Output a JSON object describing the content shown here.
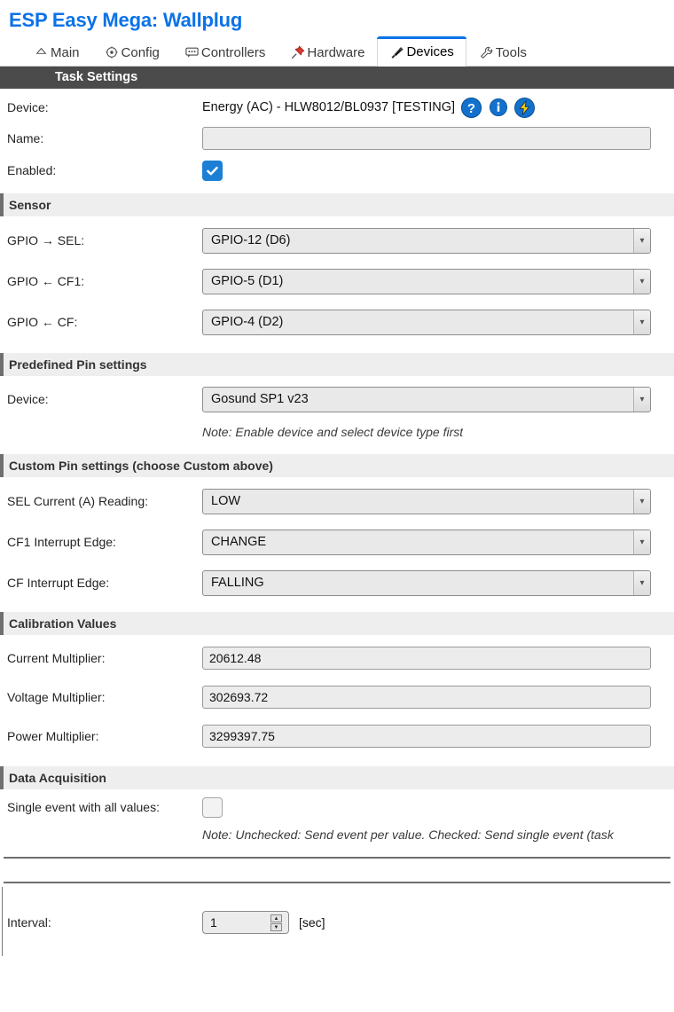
{
  "header": {
    "title": "ESP Easy Mega: Wallplug",
    "title_color": "#0b72e7"
  },
  "tabs": [
    {
      "label": "Main",
      "icon": "home-icon",
      "active": false
    },
    {
      "label": "Config",
      "icon": "gear-icon",
      "active": false
    },
    {
      "label": "Controllers",
      "icon": "speech-bubble-icon",
      "active": false
    },
    {
      "label": "Hardware",
      "icon": "pushpin-icon",
      "active": false
    },
    {
      "label": "Devices",
      "icon": "plug-icon",
      "active": true
    },
    {
      "label": "Tools",
      "icon": "wrench-icon",
      "active": false
    }
  ],
  "task_settings": {
    "bar_label": "Task Settings",
    "bar_color": "#4b4b4b"
  },
  "device": {
    "label": "Device:",
    "value": "Energy (AC) - HLW8012/BL0937 [TESTING]",
    "icons": [
      {
        "name": "help-icon",
        "glyph": "?",
        "bg": "#1271cd",
        "fg": "#ffffff"
      },
      {
        "name": "info-icon",
        "glyph": "i",
        "bg": "#1271cd",
        "fg": "#ffffff"
      },
      {
        "name": "lightning-icon",
        "glyph": "⚡",
        "bg": "#1271cd",
        "fg": "#f4c518"
      }
    ]
  },
  "name_field": {
    "label": "Name:",
    "value": "",
    "placeholder": ""
  },
  "enabled_field": {
    "label": "Enabled:",
    "checked": true
  },
  "sensor_section": {
    "title": "Sensor",
    "rows": [
      {
        "label": "GPIO → SEL:",
        "value": "GPIO-12 (D6)",
        "name": "gpio-sel-select"
      },
      {
        "label": "GPIO ← CF1:",
        "value": "GPIO-5 (D1)",
        "name": "gpio-cf1-select"
      },
      {
        "label": "GPIO ← CF:",
        "value": "GPIO-4 (D2)",
        "name": "gpio-cf-select"
      }
    ]
  },
  "predefined_section": {
    "title": "Predefined Pin settings",
    "device_label": "Device:",
    "device_value": "Gosund SP1 v23",
    "note": "Note: Enable device and select device type first"
  },
  "custom_section": {
    "title": "Custom Pin settings (choose Custom above)",
    "rows": [
      {
        "label": "SEL Current (A) Reading:",
        "value": "LOW",
        "name": "sel-current-reading-select"
      },
      {
        "label": "CF1 Interrupt Edge:",
        "value": "CHANGE",
        "name": "cf1-interrupt-edge-select"
      },
      {
        "label": "CF Interrupt Edge:",
        "value": "FALLING",
        "name": "cf-interrupt-edge-select"
      }
    ]
  },
  "calibration_section": {
    "title": "Calibration Values",
    "rows": [
      {
        "label": "Current Multiplier:",
        "value": "20612.48",
        "name": "current-multiplier-input"
      },
      {
        "label": "Voltage Multiplier:",
        "value": "302693.72",
        "name": "voltage-multiplier-input"
      },
      {
        "label": "Power Multiplier:",
        "value": "3299397.75",
        "name": "power-multiplier-input"
      }
    ]
  },
  "data_acquisition": {
    "title": "Data Acquisition",
    "single_event_label": "Single event with all values:",
    "single_event_checked": false,
    "note": "Note: Unchecked: Send event per value. Checked: Send single event (task"
  },
  "interval": {
    "label": "Interval:",
    "value": "1",
    "unit": "[sec]"
  }
}
